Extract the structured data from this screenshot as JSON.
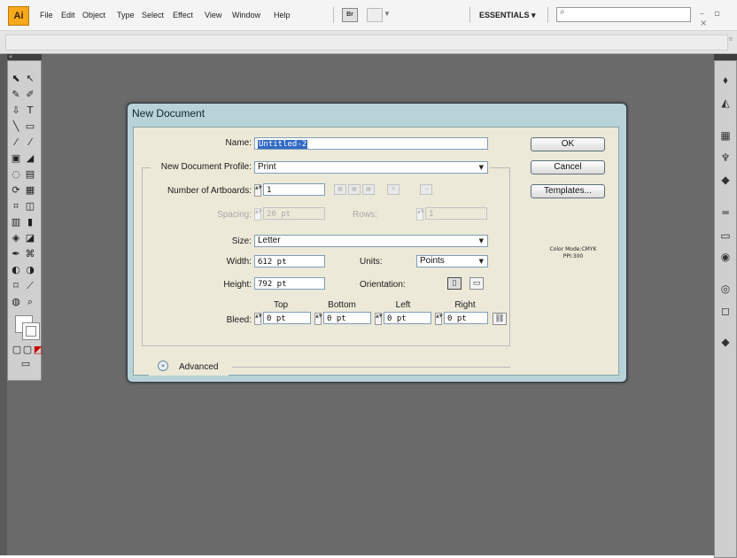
{
  "app": {
    "logo_text": "Ai",
    "menu": [
      "File",
      "Edit",
      "Object",
      "Type",
      "Select",
      "Effect",
      "View",
      "Window",
      "Help"
    ],
    "bridge_label": "Br",
    "workspace_label": "ESSENTIALS ▾",
    "search_placeholder": "",
    "window_controls": "– ▫ ×",
    "accent": "#f7a81b",
    "workspace_color": "#6a6a6a"
  },
  "tools": {
    "header_glyph": "«",
    "rows": [
      [
        "⬉",
        "↖"
      ],
      [
        "✎",
        "✐"
      ],
      [
        "⇩",
        "T"
      ],
      [
        "╲",
        "▭"
      ],
      [
        "⁄",
        "⁄"
      ],
      [
        "▣",
        "◢"
      ],
      [
        "◌",
        "▤"
      ],
      [
        "⟳",
        "▦"
      ],
      [
        "⌗",
        "◫"
      ],
      [
        "▥",
        "▮"
      ],
      [
        "◈",
        "◪"
      ],
      [
        "✒",
        "⌘"
      ],
      [
        "◐",
        "◑"
      ],
      [
        "⌑",
        "⟋"
      ],
      [
        "◍",
        "⌕"
      ]
    ],
    "mode_icons": [
      "▢",
      "▢",
      "◩"
    ],
    "screen_icon": "▭"
  },
  "dock": {
    "header_glyph": "»",
    "icons": [
      "⬧",
      "◭",
      "▦",
      "♆",
      "◆",
      "═",
      "▭",
      "◉",
      "◎",
      "◻",
      "◆"
    ]
  },
  "dialog": {
    "title": "New Document",
    "name_label": "Name:",
    "name_value": "Untitled-2",
    "profile_label": "New Document Profile:",
    "profile_value": "Print",
    "artboards_label": "Number of Artboards:",
    "artboards_value": "1",
    "artboard_layout_icons": [
      "▦",
      "▦",
      "▦",
      "X",
      "⇢"
    ],
    "spacing_label": "Spacing:",
    "spacing_value": "20 pt",
    "rows_label": "Rows:",
    "rows_value": "1",
    "size_label": "Size:",
    "size_value": "Letter",
    "width_label": "Width:",
    "width_value": "612 pt",
    "units_label": "Units:",
    "units_value": "Points",
    "height_label": "Height:",
    "height_value": "792 pt",
    "orientation_label": "Orientation:",
    "orientation_icons": [
      "▯",
      "▭"
    ],
    "bleed_label": "Bleed:",
    "bleed_top_label": "Top",
    "bleed_bottom_label": "Bottom",
    "bleed_left_label": "Left",
    "bleed_right_label": "Right",
    "bleed_top_value": "0 pt",
    "bleed_bottom_value": "0 pt",
    "bleed_left_value": "0 pt",
    "bleed_right_value": "0 pt",
    "bleed_link_icon": "⛓",
    "advanced_label": "Advanced",
    "advanced_icon": "»",
    "ok_label": "OK",
    "cancel_label": "Cancel",
    "templates_label": "Templates...",
    "color_mode_line1": "Color Mode:CMYK",
    "color_mode_line2": "PPI:300",
    "spin_glyph": "▲▼",
    "caret_glyph": "▼"
  }
}
